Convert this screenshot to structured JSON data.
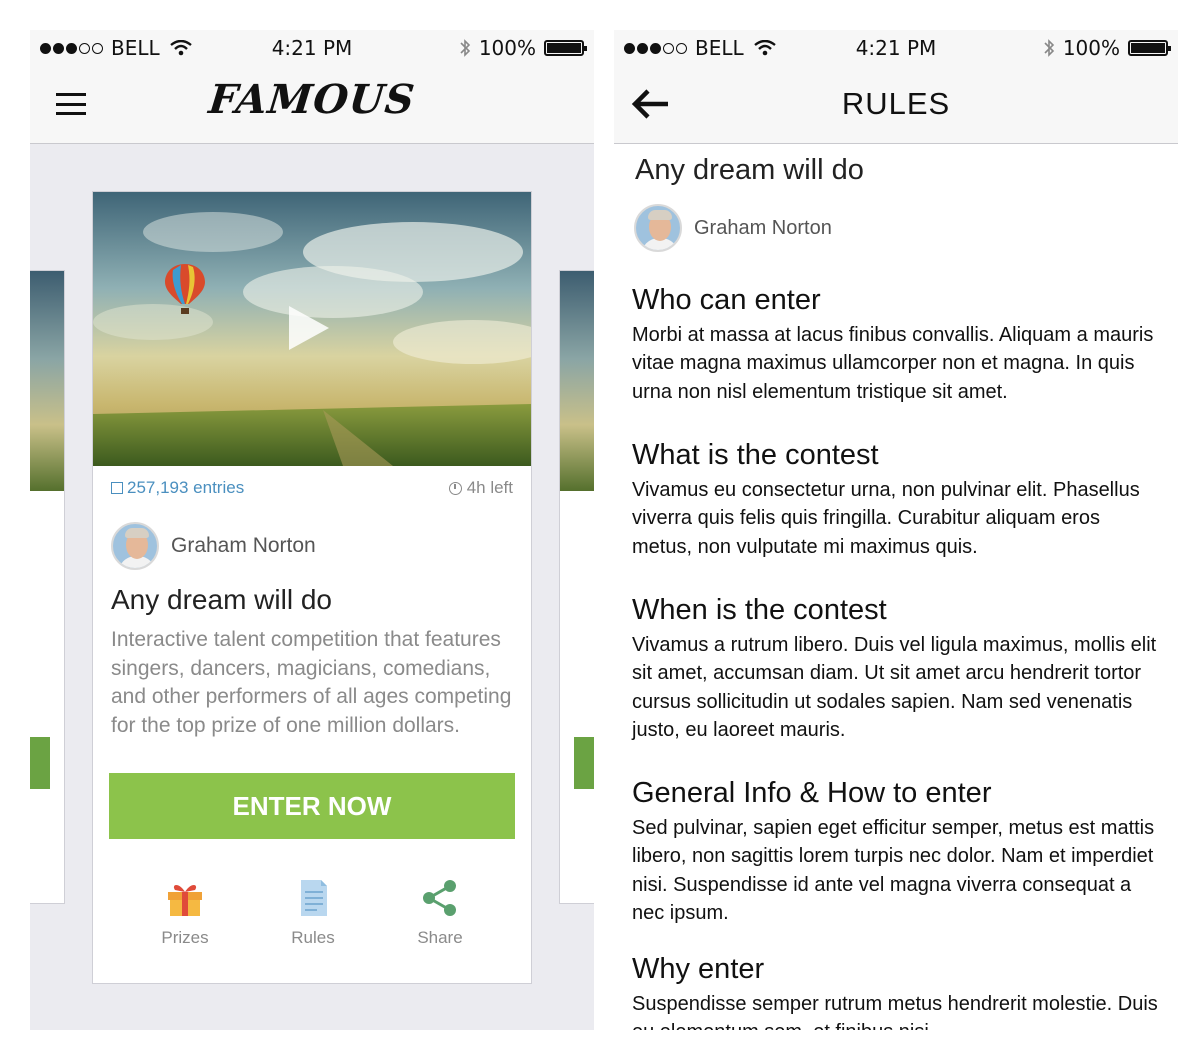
{
  "status_bar": {
    "carrier": "BELL",
    "time": "4:21 PM",
    "battery": "100%"
  },
  "left_screen": {
    "logo": "FAMOUS",
    "card": {
      "entries": "257,193 entries",
      "time_left": "4h left",
      "host": "Graham Norton",
      "title": "Any dream will do",
      "description": "Interactive talent competition that features singers, dancers, magicians, comedians, and other performers of all ages competing for the top prize of one million dollars.",
      "enter_button": "ENTER NOW",
      "actions": [
        {
          "label": "Prizes",
          "icon": "gift-icon"
        },
        {
          "label": "Rules",
          "icon": "document-icon"
        },
        {
          "label": "Share",
          "icon": "share-icon"
        }
      ]
    },
    "colors": {
      "accent_green": "#8cc34b",
      "link_blue": "#4a8fbf"
    }
  },
  "right_screen": {
    "nav_title": "RULES",
    "title": "Any dream will do",
    "host": "Graham Norton",
    "sections": [
      {
        "heading": "Who can enter",
        "body": "Morbi at massa at lacus finibus convallis. Aliquam a mauris vitae magna maximus ullamcorper non et magna. In quis urna non nisl elementum tristique sit amet."
      },
      {
        "heading": "What is the contest",
        "body": "Vivamus eu consectetur urna, non pulvinar elit. Phasellus viverra quis felis quis fringilla. Curabitur aliquam eros metus, non vulputate mi maximus quis."
      },
      {
        "heading": "When is the contest",
        "body": "Vivamus a rutrum libero. Duis vel ligula maximus, mollis elit sit amet, accumsan diam. Ut sit amet arcu hendrerit tortor cursus sollicitudin ut sodales sapien. Nam sed venenatis justo, eu laoreet mauris."
      },
      {
        "heading": "General Info & How to enter",
        "body": "Sed pulvinar, sapien eget efficitur semper, metus est mattis libero, non sagittis lorem turpis nec dolor. Nam et imperdiet nisi. Suspendisse id ante vel magna viverra consequat a nec ipsum."
      },
      {
        "heading": "Why enter",
        "body": "Suspendisse semper rutrum metus hendrerit molestie. Duis eu elementum sem, et finibus nisi."
      }
    ]
  }
}
